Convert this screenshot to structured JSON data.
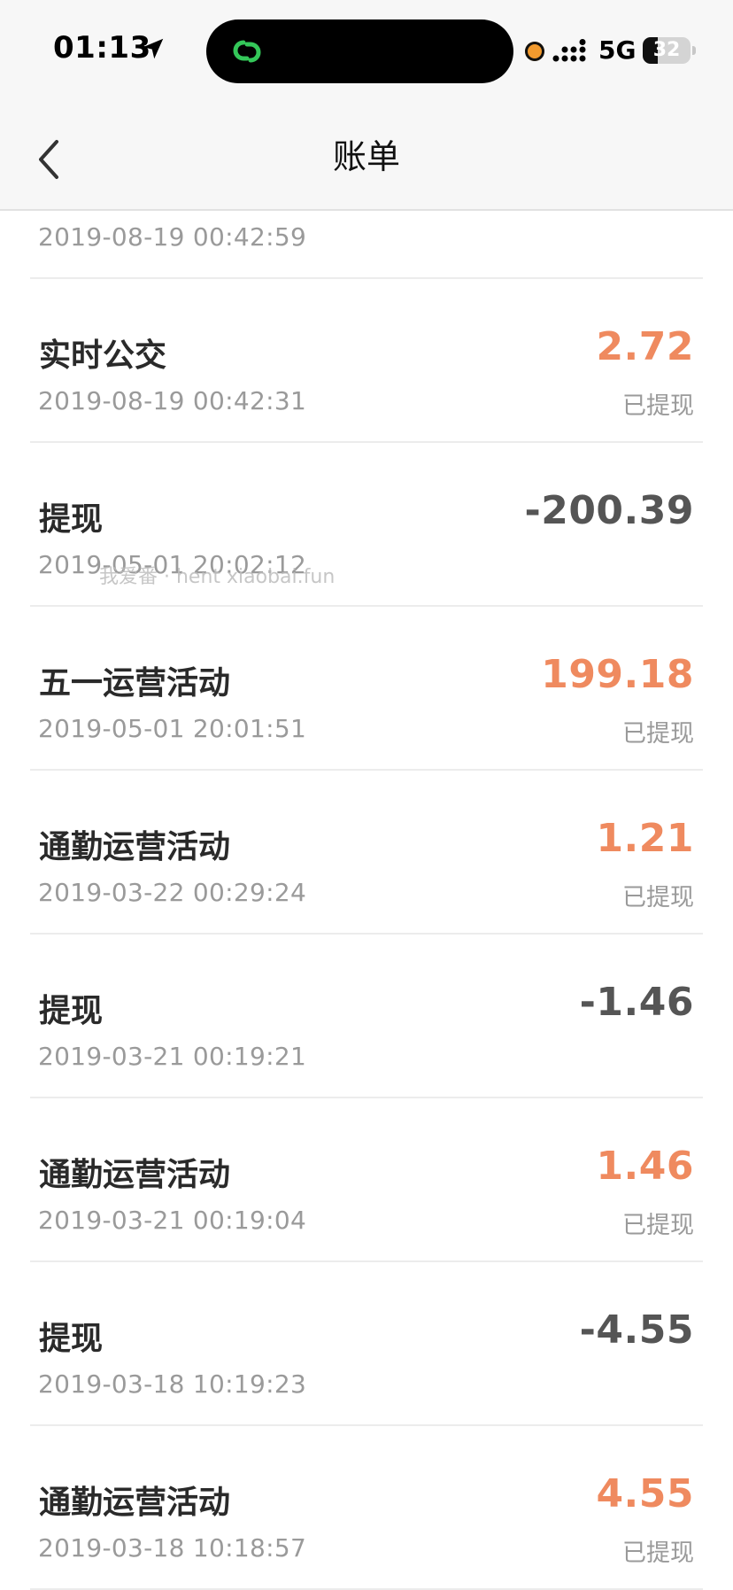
{
  "status_bar": {
    "time": "01:13",
    "network": "5G",
    "battery_level": "32",
    "battery_fraction": 0.32
  },
  "nav": {
    "title": "账单",
    "back_icon": "chevron-left-icon"
  },
  "colors": {
    "income": "#ef8a5f",
    "expense": "#555555",
    "secondary_text": "#9a9a9a"
  },
  "watermark": "我爱番 · hent xiaobai.fun",
  "bills": [
    {
      "title": "",
      "time": "2019-08-19 00:42:59",
      "amount": "",
      "type": "",
      "status": ""
    },
    {
      "title": "实时公交",
      "time": "2019-08-19 00:42:31",
      "amount": "2.72",
      "type": "income",
      "status": "已提现"
    },
    {
      "title": "提现",
      "time": "2019-05-01 20:02:12",
      "amount": "-200.39",
      "type": "expense",
      "status": ""
    },
    {
      "title": "五一运营活动",
      "time": "2019-05-01 20:01:51",
      "amount": "199.18",
      "type": "income",
      "status": "已提现"
    },
    {
      "title": "通勤运营活动",
      "time": "2019-03-22 00:29:24",
      "amount": "1.21",
      "type": "income",
      "status": "已提现"
    },
    {
      "title": "提现",
      "time": "2019-03-21 00:19:21",
      "amount": "-1.46",
      "type": "expense",
      "status": ""
    },
    {
      "title": "通勤运营活动",
      "time": "2019-03-21 00:19:04",
      "amount": "1.46",
      "type": "income",
      "status": "已提现"
    },
    {
      "title": "提现",
      "time": "2019-03-18 10:19:23",
      "amount": "-4.55",
      "type": "expense",
      "status": ""
    },
    {
      "title": "通勤运营活动",
      "time": "2019-03-18 10:18:57",
      "amount": "4.55",
      "type": "income",
      "status": "已提现"
    }
  ]
}
